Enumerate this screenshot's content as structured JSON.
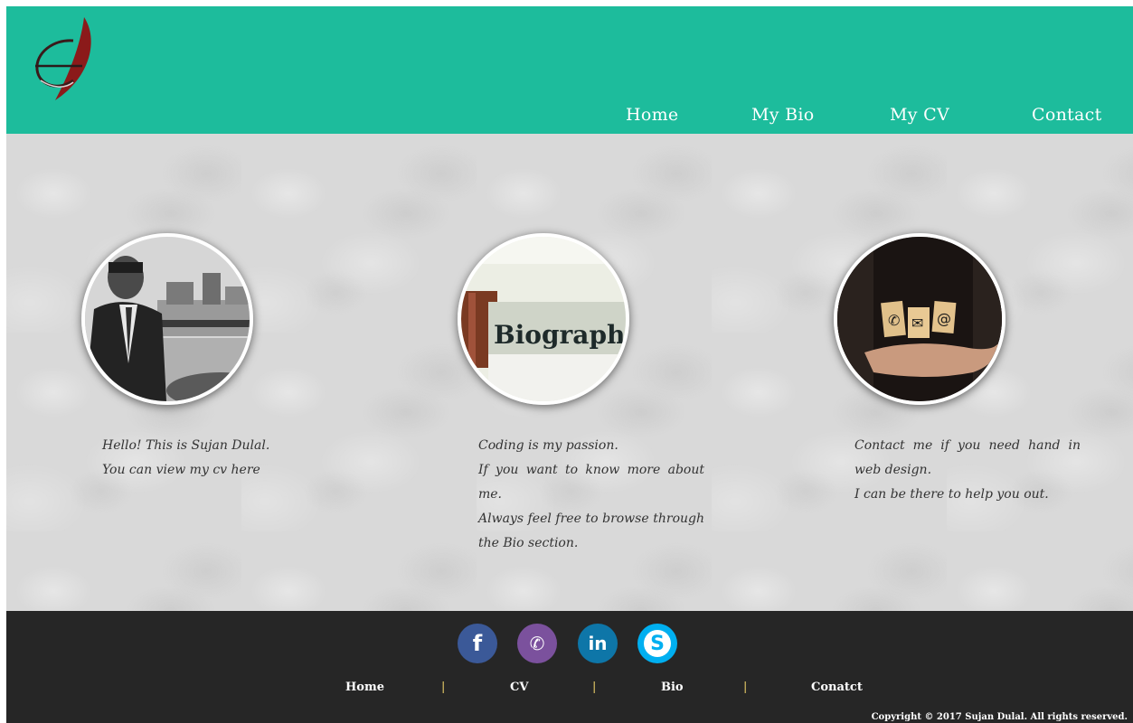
{
  "header": {
    "logo_icon": "logo-icon",
    "nav": [
      {
        "label": "Home"
      },
      {
        "label": "My Bio"
      },
      {
        "label": "My CV"
      },
      {
        "label": "Contact"
      }
    ]
  },
  "cards": [
    {
      "image": "portrait-photo",
      "lines": [
        "Hello! This is Sujan Dulal.",
        "You can view my cv here"
      ]
    },
    {
      "image": "biography-photo",
      "image_text": "Biography",
      "lines": [
        "Coding is my passion.",
        "If you want to know more about me.",
        "Always feel free to browse through the Bio section."
      ]
    },
    {
      "image": "contact-photo",
      "lines": [
        "Contact me if you need hand in web design.",
        "I can be there to help you out."
      ]
    }
  ],
  "footer": {
    "social": [
      {
        "icon": "facebook-icon",
        "glyph": "f",
        "color": "#3b5998"
      },
      {
        "icon": "viber-icon",
        "glyph": "✆",
        "color": "#7b519d"
      },
      {
        "icon": "linkedin-icon",
        "glyph": "in",
        "color": "#0e76a8"
      },
      {
        "icon": "skype-icon",
        "glyph": "S",
        "color": "#00aff0"
      }
    ],
    "nav": [
      {
        "label": "Home"
      },
      {
        "label": "CV"
      },
      {
        "label": "Bio"
      },
      {
        "label": "Conatct"
      }
    ],
    "separator": "|",
    "copyright": "Copyright © 2017 Sujan Dulal. All rights reserved."
  },
  "colors": {
    "header_bg": "#1dbc9c",
    "footer_bg": "#262626",
    "logo_red": "#8b1a1a"
  }
}
